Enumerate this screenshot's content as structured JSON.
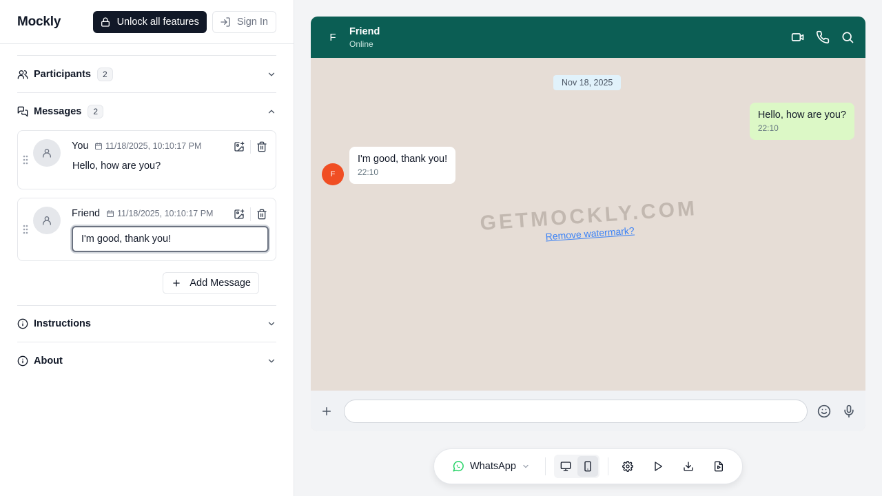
{
  "app": {
    "logo": "Mockly",
    "unlock_label": "Unlock all features",
    "signin_label": "Sign In"
  },
  "sections": {
    "participants": {
      "title": "Participants",
      "count": "2"
    },
    "messages": {
      "title": "Messages",
      "count": "2"
    },
    "instructions": {
      "title": "Instructions"
    },
    "about": {
      "title": "About"
    }
  },
  "messages": [
    {
      "sender": "You",
      "timestamp": "11/18/2025, 10:10:17 PM",
      "text": "Hello, how are you?"
    },
    {
      "sender": "Friend",
      "timestamp": "11/18/2025, 10:10:17 PM",
      "text": "I'm good, thank you!"
    }
  ],
  "add_message_label": "Add Message",
  "chat": {
    "contact_initial": "F",
    "contact_name": "Friend",
    "contact_status": "Online",
    "date_label": "Nov 18, 2025",
    "outgoing": {
      "text": "Hello, how are you?",
      "time": "22:10"
    },
    "incoming": {
      "text": "I'm good, thank you!",
      "time": "22:10",
      "avatar_initial": "F"
    },
    "watermark": "GETMOCKLY.COM",
    "watermark_link": "Remove watermark?",
    "header_color": "#0b5e54",
    "outgoing_bubble_color": "#dcf8c6",
    "background_color": "#e6ddd6"
  },
  "toolbar": {
    "platform": "WhatsApp",
    "platform_icon": "whatsapp-icon",
    "platform_color": "#25d366"
  }
}
